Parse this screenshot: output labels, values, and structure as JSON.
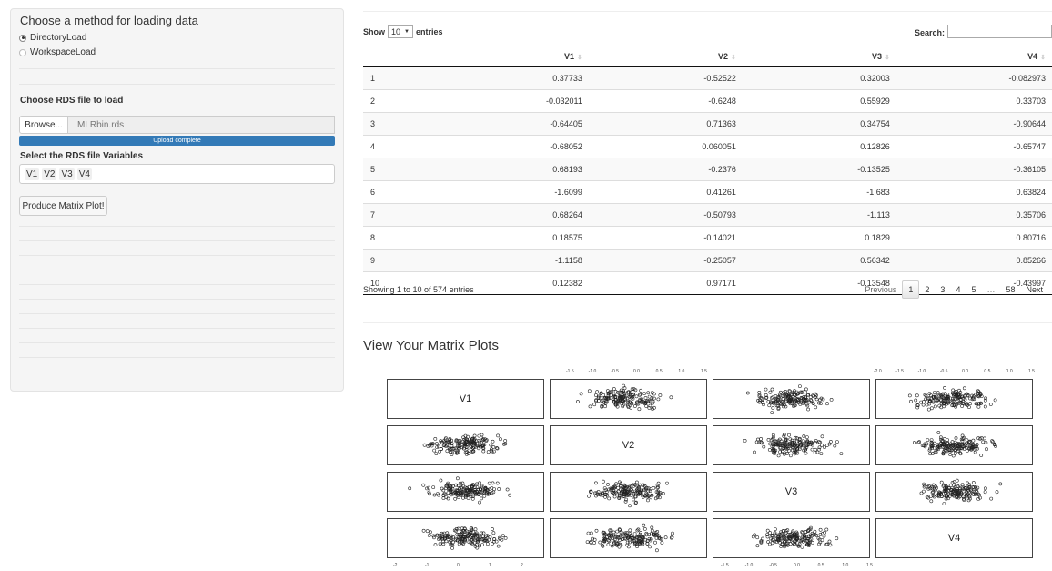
{
  "sidebar": {
    "title": "Choose a method for loading data",
    "radios": [
      {
        "label": "DirectoryLoad",
        "selected": true
      },
      {
        "label": "WorkspaceLoad",
        "selected": false
      }
    ],
    "rds_label": "Choose RDS file to load",
    "browse_label": "Browse...",
    "file_name": "MLRbin.rds",
    "upload_status": "Upload complete",
    "upload_progress": 1.0,
    "variables_label": "Select the RDS file Variables",
    "variables": [
      "V1",
      "V2",
      "V3",
      "V4"
    ],
    "produce_button": "Produce Matrix Plot!"
  },
  "table": {
    "show_label": "Show",
    "length_value": "10",
    "entries_label": "entries",
    "search_label": "Search:",
    "columns": [
      "",
      "V1",
      "V2",
      "V3",
      "V4"
    ],
    "rows": [
      [
        "1",
        "0.37733",
        "-0.52522",
        "0.32003",
        "-0.082973"
      ],
      [
        "2",
        "-0.032011",
        "-0.6248",
        "0.55929",
        "0.33703"
      ],
      [
        "3",
        "-0.64405",
        "0.71363",
        "0.34754",
        "-0.90644"
      ],
      [
        "4",
        "-0.68052",
        "0.060051",
        "0.12826",
        "-0.65747"
      ],
      [
        "5",
        "0.68193",
        "-0.2376",
        "-0.13525",
        "-0.36105"
      ],
      [
        "6",
        "-1.6099",
        "0.41261",
        "-1.683",
        "0.63824"
      ],
      [
        "7",
        "0.68264",
        "-0.50793",
        "-1.113",
        "0.35706"
      ],
      [
        "8",
        "0.18575",
        "-0.14021",
        "0.1829",
        "0.80716"
      ],
      [
        "9",
        "-1.1158",
        "-0.25057",
        "0.56342",
        "0.85266"
      ],
      [
        "10",
        "0.12382",
        "0.97171",
        "-0.13548",
        "-0.43997"
      ]
    ],
    "info": "Showing 1 to 10 of 574 entries",
    "pager": [
      "Previous",
      "1",
      "2",
      "3",
      "4",
      "5",
      "…",
      "58",
      "Next"
    ],
    "current_page": "1"
  },
  "plot": {
    "title": "View Your Matrix Plots",
    "labels": [
      "V1",
      "V2",
      "V3",
      "V4"
    ],
    "top_ticks_a": [
      "-1.5",
      "-1.0",
      "-0.5",
      "0.0",
      "0.5",
      "1.0",
      "1.5"
    ],
    "top_ticks_b": [
      "-2.0",
      "-1.5",
      "-1.0",
      "-0.5",
      "0.0",
      "0.5",
      "1.0",
      "1.5"
    ],
    "bottom_ticks_a": [
      "-2",
      "-1",
      "0",
      "1",
      "2"
    ],
    "bottom_ticks_b": [
      "-1.5",
      "-1.0",
      "-0.5",
      "0.0",
      "0.5",
      "1.0",
      "1.5"
    ]
  }
}
